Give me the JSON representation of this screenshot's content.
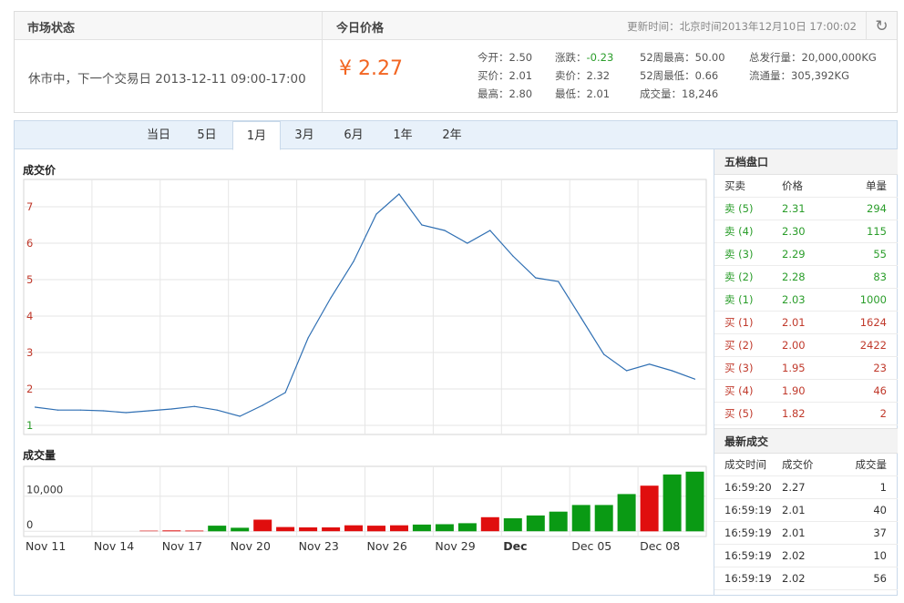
{
  "top": {
    "market_state_title": "市场状态",
    "price_title": "今日价格",
    "update_time": "更新时间：北京时间2013年12月10日 17:00:02",
    "market_state": "休市中，下一个交易日 2013-12-11 09:00-17:00",
    "price": "¥ 2.27",
    "stats": [
      {
        "label": "今开：",
        "value": "2.50"
      },
      {
        "label": "涨跌：",
        "value": "-0.23"
      },
      {
        "label": "52周最高：",
        "value": "50.00"
      },
      {
        "label": "总发行量：",
        "value": "20,000,000KG"
      },
      {
        "label": "买价：",
        "value": "2.01"
      },
      {
        "label": "卖价：",
        "value": "2.32"
      },
      {
        "label": "52周最低：",
        "value": "0.66"
      },
      {
        "label": "流通量：",
        "value": "305,392KG"
      },
      {
        "label": "最高：",
        "value": "2.80"
      },
      {
        "label": "最低：",
        "value": "2.01"
      },
      {
        "label": "成交量：",
        "value": "18,246"
      }
    ]
  },
  "tabs": [
    "当日",
    "5日",
    "1月",
    "3月",
    "6月",
    "1年",
    "2年"
  ],
  "active_tab": "1月",
  "chart_data": [
    {
      "type": "line",
      "title": "成交价",
      "yticks": [
        1,
        2,
        3,
        4,
        5,
        6,
        7
      ],
      "ylim": [
        0.75,
        7.75
      ],
      "values": [
        1.5,
        1.42,
        1.42,
        1.4,
        1.35,
        1.4,
        1.45,
        1.52,
        1.42,
        1.25,
        1.55,
        1.9,
        3.4,
        4.5,
        5.5,
        6.8,
        7.35,
        6.5,
        6.35,
        6.0,
        6.35,
        5.65,
        5.05,
        4.95,
        3.95,
        2.95,
        2.5,
        2.68,
        2.5,
        2.27
      ],
      "grid": true
    },
    {
      "type": "bar",
      "title": "成交量",
      "yticks": [
        0,
        10000
      ],
      "ytick_labels": [
        "0",
        "10,000"
      ],
      "ylim": [
        -1500,
        18500
      ],
      "xtick_labels": [
        "Nov 11",
        "Nov 14",
        "Nov 17",
        "Nov 20",
        "Nov 23",
        "Nov 26",
        "Nov 29",
        "Dec",
        "Dec 05",
        "Dec 08"
      ],
      "bold_tick": "Dec",
      "values": [
        0,
        0,
        0,
        0,
        0,
        150,
        250,
        200,
        1600,
        1000,
        3300,
        1200,
        1100,
        1100,
        1700,
        1600,
        1700,
        1900,
        2000,
        2300,
        4000,
        3700,
        4500,
        5600,
        7500,
        7500,
        10600,
        13000,
        16200,
        17000
      ],
      "colors": [
        "up",
        "up",
        "up",
        "up",
        "up",
        "down",
        "down",
        "down",
        "up",
        "up",
        "down",
        "down",
        "down",
        "down",
        "down",
        "down",
        "down",
        "up",
        "up",
        "up",
        "down",
        "up",
        "up",
        "up",
        "up",
        "up",
        "up",
        "down",
        "up",
        "up"
      ]
    }
  ],
  "colors": {
    "up": "#0a9a14",
    "down": "#e00e0e",
    "line": "#2f6fb3",
    "price": "#f26522"
  },
  "order_book": {
    "title": "五档盘口",
    "headers": [
      "买卖",
      "价格",
      "单量"
    ],
    "rows": [
      {
        "side": "卖 (5)",
        "price": "2.31",
        "qty": "294",
        "type": "sell"
      },
      {
        "side": "卖 (4)",
        "price": "2.30",
        "qty": "115",
        "type": "sell"
      },
      {
        "side": "卖 (3)",
        "price": "2.29",
        "qty": "55",
        "type": "sell"
      },
      {
        "side": "卖 (2)",
        "price": "2.28",
        "qty": "83",
        "type": "sell"
      },
      {
        "side": "卖 (1)",
        "price": "2.03",
        "qty": "1000",
        "type": "sell"
      },
      {
        "side": "买 (1)",
        "price": "2.01",
        "qty": "1624",
        "type": "buy"
      },
      {
        "side": "买 (2)",
        "price": "2.00",
        "qty": "2422",
        "type": "buy"
      },
      {
        "side": "买 (3)",
        "price": "1.95",
        "qty": "23",
        "type": "buy"
      },
      {
        "side": "买 (4)",
        "price": "1.90",
        "qty": "46",
        "type": "buy"
      },
      {
        "side": "买 (5)",
        "price": "1.82",
        "qty": "2",
        "type": "buy"
      }
    ]
  },
  "trades": {
    "title": "最新成交",
    "headers": [
      "成交时间",
      "成交价",
      "成交量"
    ],
    "rows": [
      {
        "time": "16:59:20",
        "price": "2.27",
        "qty": "1"
      },
      {
        "time": "16:59:19",
        "price": "2.01",
        "qty": "40"
      },
      {
        "time": "16:59:19",
        "price": "2.01",
        "qty": "37"
      },
      {
        "time": "16:59:19",
        "price": "2.02",
        "qty": "10"
      },
      {
        "time": "16:59:19",
        "price": "2.02",
        "qty": "56"
      }
    ]
  }
}
